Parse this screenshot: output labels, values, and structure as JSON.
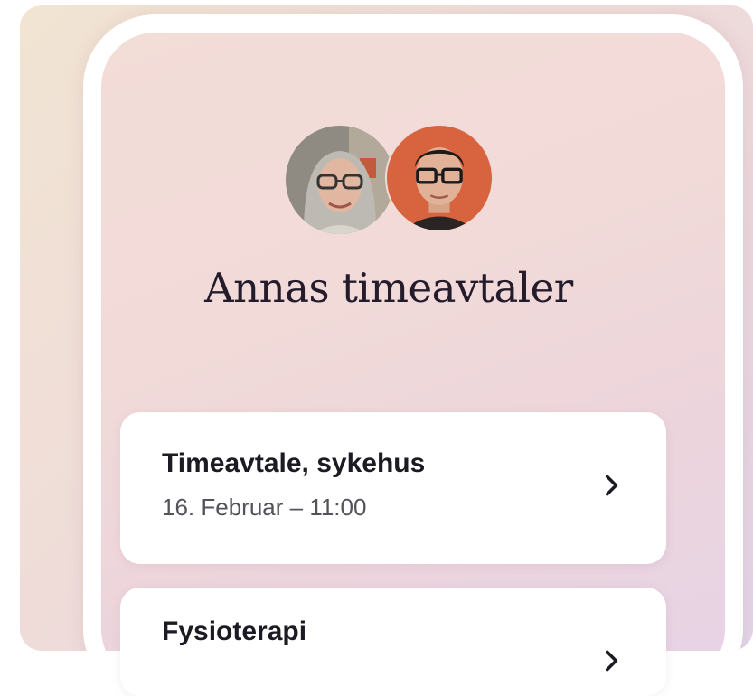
{
  "header": {
    "title": "Annas timeavtaler"
  },
  "avatars": [
    {
      "name": "avatar-anna",
      "icon": "person-photo-icon"
    },
    {
      "name": "avatar-man",
      "icon": "person-photo-icon"
    }
  ],
  "appointments": [
    {
      "title": "Timeavtale, sykehus",
      "date": "16. Februar – 11:00",
      "icon": "chevron-right-icon"
    },
    {
      "title": "Fysioterapi",
      "date": "",
      "icon": "chevron-right-icon"
    }
  ],
  "colors": {
    "title_text": "#241b2b",
    "card_bg": "#ffffff",
    "secondary_text": "#55525a",
    "accent_orange": "#d8633f"
  }
}
